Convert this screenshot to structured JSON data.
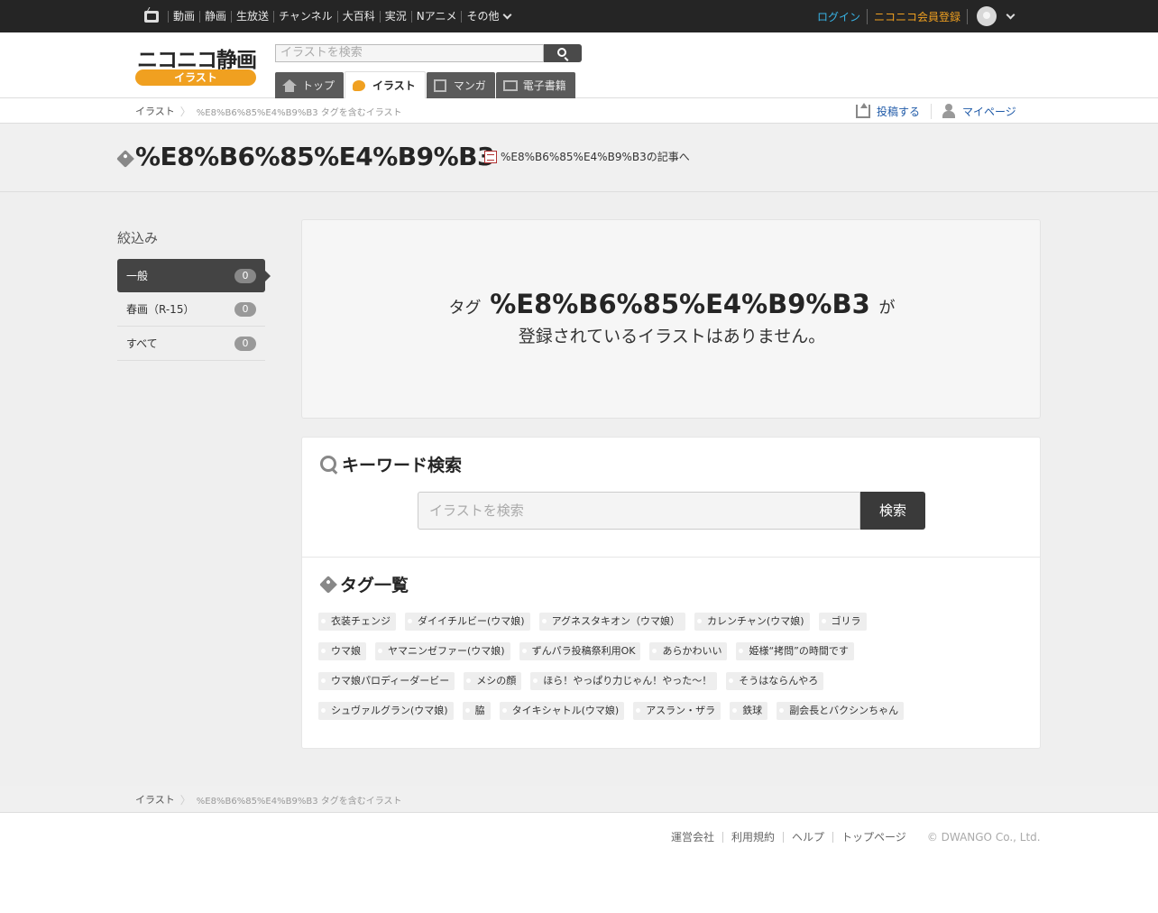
{
  "topbar": {
    "nav": [
      "動画",
      "静画",
      "生放送",
      "チャンネル",
      "大百科",
      "実況",
      "Nアニメ"
    ],
    "more_label": "その他",
    "login": "ログイン",
    "register": "ニコニコ会員登録"
  },
  "header": {
    "logo_text": "ニコニコ静画",
    "logo_sub": "イラスト",
    "search_placeholder": "イラストを検索",
    "tabs": [
      {
        "label": "トップ",
        "icon": "home-icon"
      },
      {
        "label": "イラスト",
        "icon": "palette-icon"
      },
      {
        "label": "マンガ",
        "icon": "manga-icon"
      },
      {
        "label": "電子書籍",
        "icon": "book-icon"
      }
    ],
    "active_tab": 1
  },
  "subnav": {
    "breadcrumb_home": "イラスト",
    "breadcrumb_current": "%E8%B6%85%E4%B9%B3 タグを含むイラスト",
    "post_label": "投稿する",
    "mypage_label": "マイページ"
  },
  "title": {
    "tag": "%E8%B6%85%E4%B9%B3",
    "article_link": "%E8%B6%85%E4%B9%B3の記事へ"
  },
  "filter": {
    "title": "絞込み",
    "items": [
      {
        "label": "一般",
        "count": "0"
      },
      {
        "label": "春画（R-15）",
        "count": "0"
      },
      {
        "label": "すべて",
        "count": "0"
      }
    ],
    "active": 0
  },
  "empty": {
    "prefix": "タグ",
    "tag": "%E8%B6%85%E4%B9%B3",
    "suffix": "が",
    "line2": "登録されているイラストはありません。"
  },
  "keyword": {
    "title": "キーワード検索",
    "placeholder": "イラストを検索",
    "button": "検索"
  },
  "tags": {
    "title": "タグ一覧",
    "rows": [
      [
        "衣装チェンジ",
        "ダイイチルビー(ウマ娘)",
        "アグネスタキオン（ウマ娘）",
        "カレンチャン(ウマ娘)",
        "ゴリラ"
      ],
      [
        "ウマ娘",
        "ヤマニンゼファー(ウマ娘)",
        "ずんパラ投稿祭利用OK",
        "あらかわいい",
        "姫様“拷問”の時間です"
      ],
      [
        "ウマ娘パロディーダービー",
        "メシの顔",
        "ほら！やっぱり力じゃん！やった～！",
        "そうはならんやろ"
      ],
      [
        "シュヴァルグラン(ウマ娘)",
        "脇",
        "タイキシャトル(ウマ娘)",
        "アスラン・ザラ",
        "鉄球",
        "副会長とバクシンちゃん"
      ]
    ]
  },
  "footer": {
    "breadcrumb_home": "イラスト",
    "breadcrumb_current": "%E8%B6%85%E4%B9%B3 タグを含むイラスト",
    "links": [
      "運営会社",
      "利用規約",
      "ヘルプ",
      "トップページ"
    ],
    "copyright": "© DWANGO Co., Ltd."
  },
  "colors": {
    "topbar": "#252525",
    "brand_orange": "#f0a020",
    "login_blue": "#38b4e6",
    "link_blue": "#1f5aa8"
  }
}
